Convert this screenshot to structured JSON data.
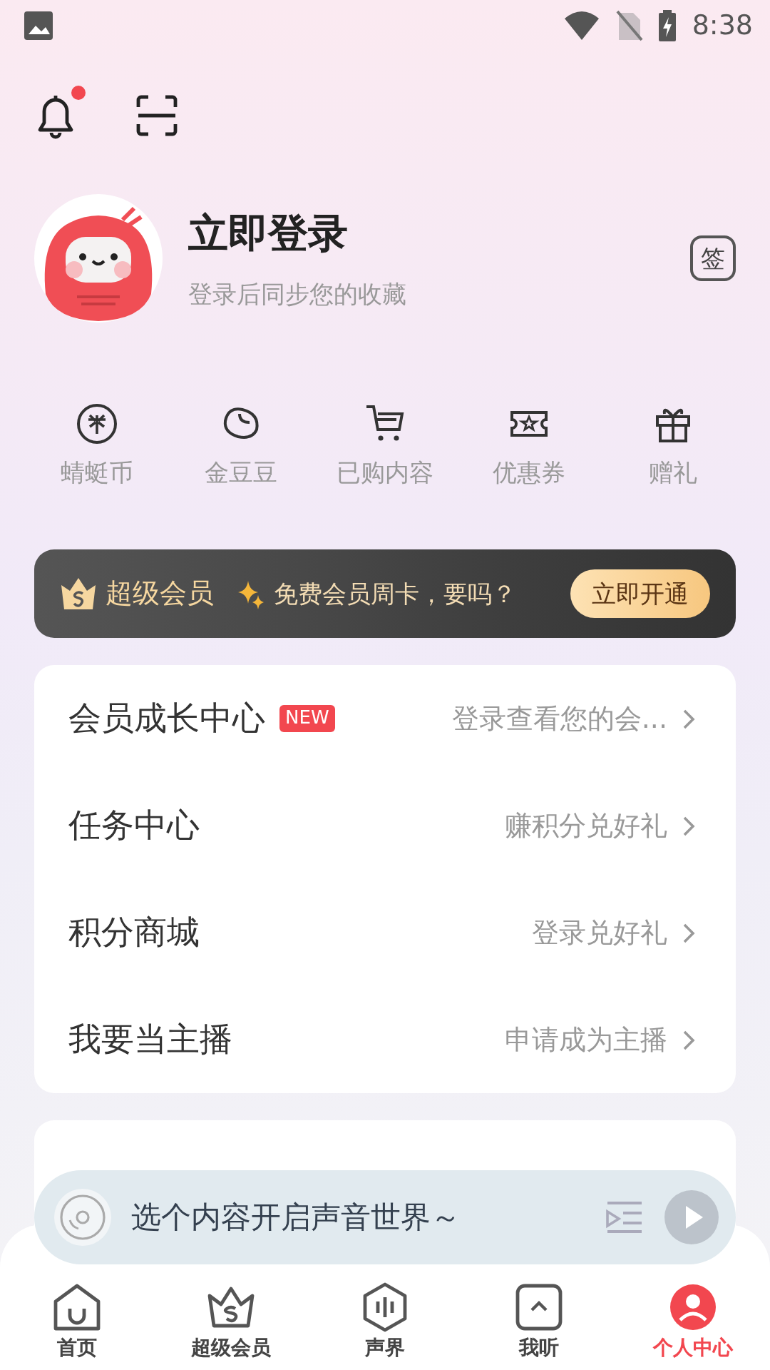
{
  "status_bar": {
    "time": "8:38"
  },
  "header": {
    "notification_dot": true
  },
  "profile": {
    "title": "立即登录",
    "subtitle": "登录后同步您的收藏",
    "sign_badge": "签"
  },
  "shortcuts": [
    {
      "kind": "coin",
      "label": "蜻蜓币"
    },
    {
      "kind": "bean",
      "label": "金豆豆"
    },
    {
      "kind": "cart",
      "label": "已购内容"
    },
    {
      "kind": "ticket",
      "label": "优惠券"
    },
    {
      "kind": "gift",
      "label": "赠礼"
    }
  ],
  "vip_banner": {
    "title": "超级会员",
    "promo": "免费会员周卡，要吗？",
    "button": "立即开通"
  },
  "menu": [
    {
      "label": "会员成长中心",
      "badge": "NEW",
      "hint": "登录查看您的会..."
    },
    {
      "label": "任务中心",
      "hint": "赚积分兑好礼"
    },
    {
      "label": "积分商城",
      "hint": "登录兑好礼"
    },
    {
      "label": "我要当主播",
      "hint": "申请成为主播"
    }
  ],
  "player": {
    "text": "选个内容开启声音世界～"
  },
  "tab_bar": [
    {
      "kind": "home",
      "label": "首页",
      "selected": false
    },
    {
      "kind": "vip",
      "label": "超级会员",
      "selected": false
    },
    {
      "kind": "sound",
      "label": "声界",
      "selected": false
    },
    {
      "kind": "listen",
      "label": "我听",
      "selected": false
    },
    {
      "kind": "me",
      "label": "个人中心",
      "selected": true
    }
  ]
}
